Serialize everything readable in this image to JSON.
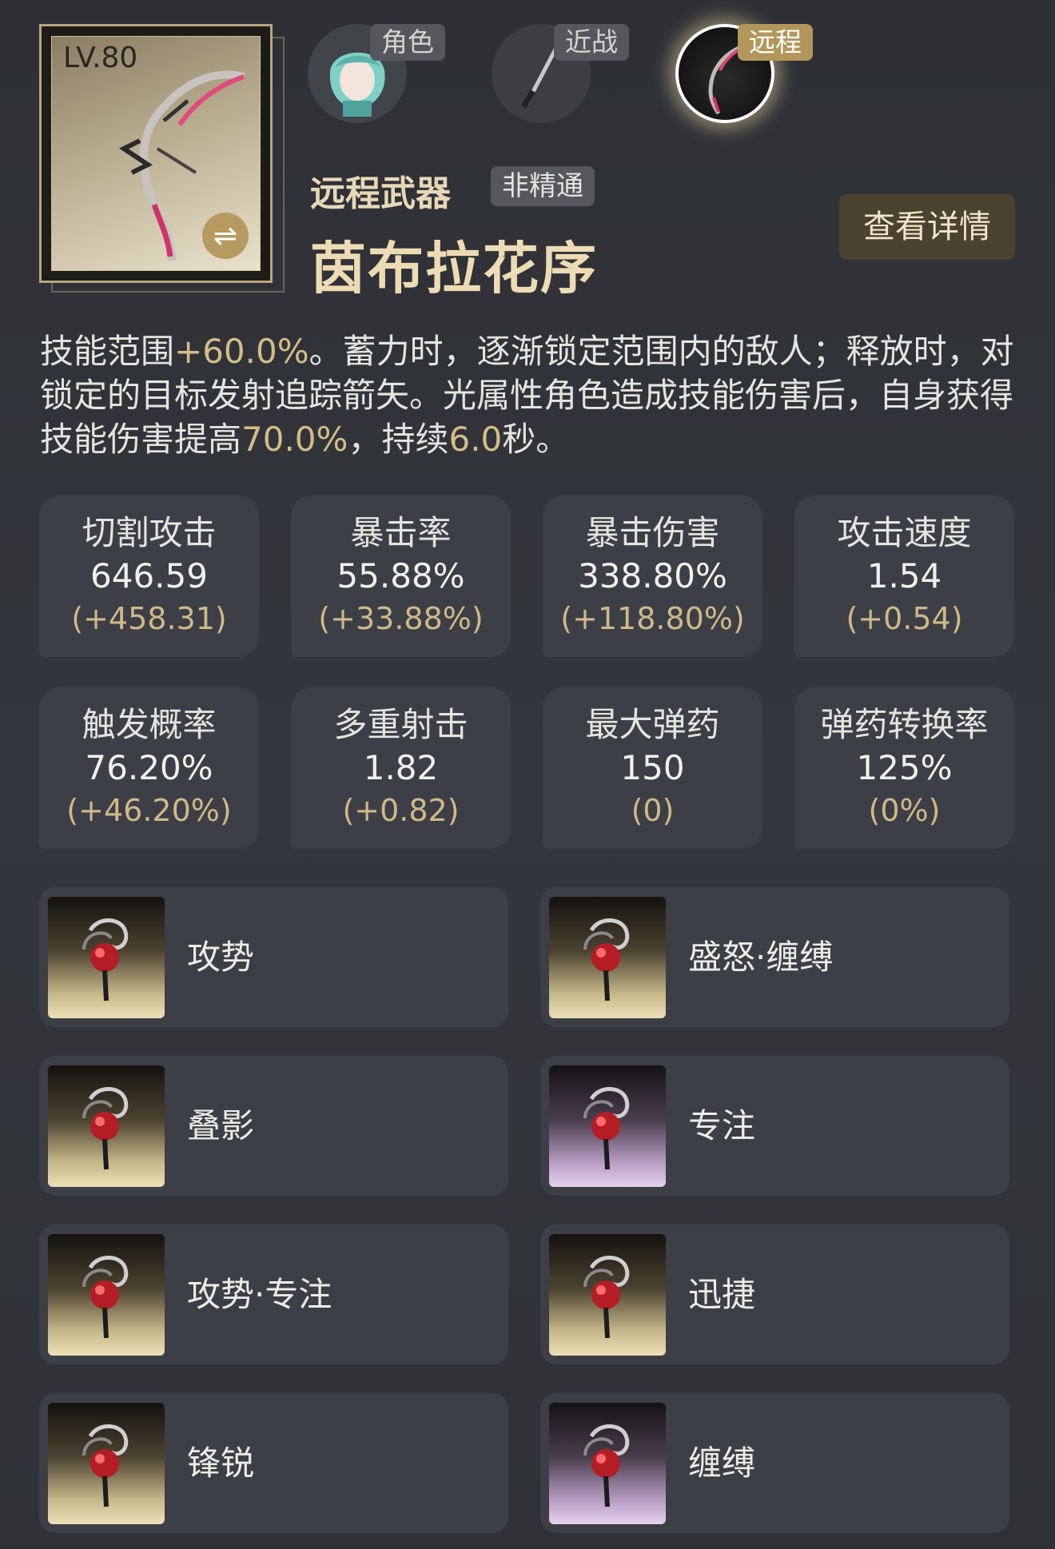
{
  "weapon_card": {
    "level": "LV.80",
    "swap_icon": "swap-arrows-icon"
  },
  "tabs": [
    {
      "label": "角色",
      "icon": "character-portrait-icon",
      "active": false
    },
    {
      "label": "近战",
      "icon": "melee-weapon-icon",
      "active": false
    },
    {
      "label": "远程",
      "icon": "ranged-weapon-icon",
      "active": true
    }
  ],
  "header": {
    "weapon_type": "远程武器",
    "mastery": "非精通",
    "weapon_name": "茵布拉花序",
    "detail_button": "查看详情"
  },
  "description": {
    "p1": "技能范围",
    "h1": "+60.0%",
    "p2": "。蓄力时，逐渐锁定范围内的敌人；释放时，对锁定的目标发射追踪箭矢。光属性角色造成技能伤害后，自身获得技能伤害提高",
    "h2": "70.0%",
    "p3": "，持续",
    "h3": "6.0",
    "p4": "秒。"
  },
  "stats": [
    {
      "name": "切割攻击",
      "value": "646.59",
      "bonus": "(+458.31)"
    },
    {
      "name": "暴击率",
      "value": "55.88%",
      "bonus": "(+33.88%)"
    },
    {
      "name": "暴击伤害",
      "value": "338.80%",
      "bonus": "(+118.80%)"
    },
    {
      "name": "攻击速度",
      "value": "1.54",
      "bonus": "(+0.54)"
    },
    {
      "name": "触发概率",
      "value": "76.20%",
      "bonus": "(+46.20%)"
    },
    {
      "name": "多重射击",
      "value": "1.82",
      "bonus": "(+0.82)"
    },
    {
      "name": "最大弹药",
      "value": "150",
      "bonus": "(0)"
    },
    {
      "name": "弹药转换率",
      "value": "125%",
      "bonus": "(0%)"
    }
  ],
  "skills": [
    {
      "label": "攻势",
      "tier": "gold"
    },
    {
      "label": "盛怒·缠缚",
      "tier": "gold"
    },
    {
      "label": "叠影",
      "tier": "gold"
    },
    {
      "label": "专注",
      "tier": "purple"
    },
    {
      "label": "攻势·专注",
      "tier": "gold"
    },
    {
      "label": "迅捷",
      "tier": "gold"
    },
    {
      "label": "锋锐",
      "tier": "gold"
    },
    {
      "label": "缠缚",
      "tier": "purple"
    }
  ],
  "colors": {
    "accent_gold": "#b3965a",
    "highlight": "#d4bd86",
    "panel": "#3c3f45"
  }
}
